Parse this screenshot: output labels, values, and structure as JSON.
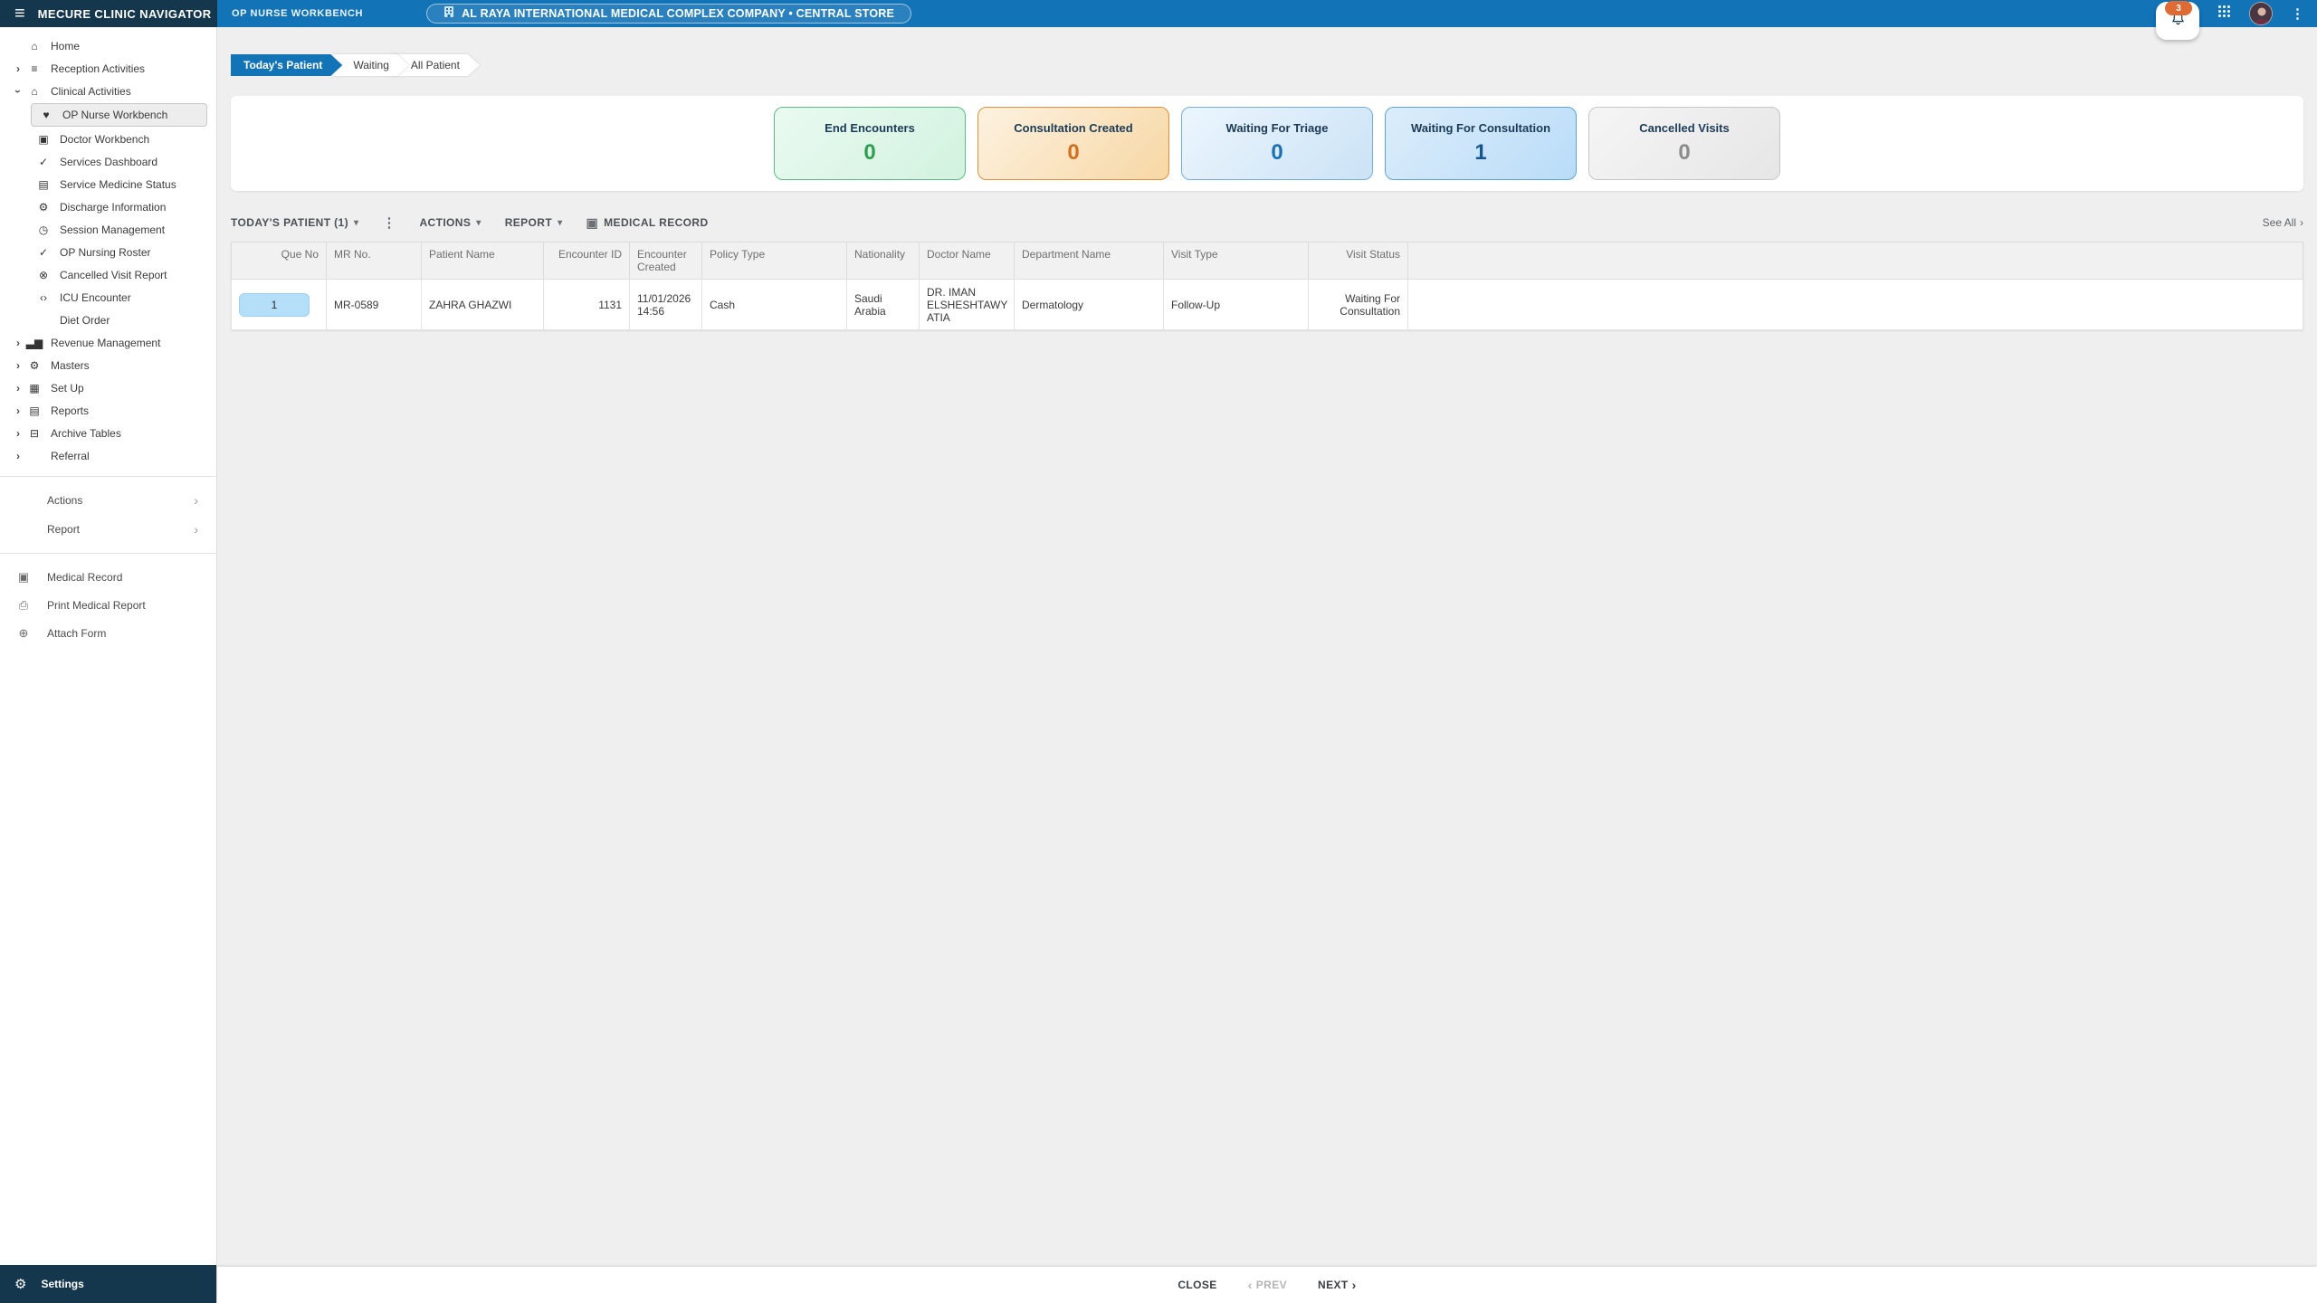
{
  "header": {
    "app_title": "MECURE CLINIC NAVIGATOR",
    "module_label": "OP NURSE WORKBENCH",
    "location_pill": "AL RAYA INTERNATIONAL MEDICAL COMPLEX COMPANY • CENTRAL STORE",
    "notification_count": "3"
  },
  "colors": {
    "primary_blue": "#1273b7",
    "navy": "#14374e",
    "notification_badge_orange": "#dd6b33",
    "card_green_border": "#5fbb85",
    "card_orange_border": "#e0903c",
    "card_blue_border": "#74aedd",
    "card_gray_border": "#c6c6c6",
    "que_badge_blue": "#b5dff8"
  },
  "sidebar": {
    "items": [
      {
        "label": "Home",
        "icon": "home",
        "glyph": "⌂",
        "level": 0,
        "chevron": null,
        "selected": false
      },
      {
        "label": "Reception Activities",
        "icon": "menu-lines",
        "glyph": "≡",
        "level": 0,
        "chevron": "right",
        "selected": false
      },
      {
        "label": "Clinical Activities",
        "icon": "clinic-building",
        "glyph": "⌂",
        "level": 0,
        "chevron": "down",
        "selected": false
      },
      {
        "label": "OP Nurse Workbench",
        "icon": "nurse-heart",
        "glyph": "♥",
        "level": 1,
        "chevron": null,
        "selected": true
      },
      {
        "label": "Doctor Workbench",
        "icon": "doctor-card",
        "glyph": "▣",
        "level": 1,
        "chevron": null,
        "selected": false
      },
      {
        "label": "Services Dashboard",
        "icon": "check",
        "glyph": "✓",
        "level": 1,
        "chevron": null,
        "selected": false
      },
      {
        "label": "Service Medicine Status",
        "icon": "list",
        "glyph": "▤",
        "level": 1,
        "chevron": null,
        "selected": false
      },
      {
        "label": "Discharge Information",
        "icon": "gear",
        "glyph": "⚙",
        "level": 1,
        "chevron": null,
        "selected": false
      },
      {
        "label": "Session Management",
        "icon": "clock",
        "glyph": "◷",
        "level": 1,
        "chevron": null,
        "selected": false
      },
      {
        "label": "OP Nursing Roster",
        "icon": "check",
        "glyph": "✓",
        "level": 1,
        "chevron": null,
        "selected": false
      },
      {
        "label": "Cancelled Visit Report",
        "icon": "cancel-circle",
        "glyph": "⊗",
        "level": 1,
        "chevron": null,
        "selected": false
      },
      {
        "label": "ICU Encounter",
        "icon": "code-brackets",
        "glyph": "‹›",
        "level": 1,
        "chevron": null,
        "selected": false
      },
      {
        "label": "Diet Order",
        "icon": "none",
        "glyph": "",
        "level": 1,
        "chevron": null,
        "selected": false
      },
      {
        "label": "Revenue Management",
        "icon": "bar-chart",
        "glyph": "▃▆",
        "level": 0,
        "chevron": "right",
        "selected": false
      },
      {
        "label": "Masters",
        "icon": "gear",
        "glyph": "⚙",
        "level": 0,
        "chevron": "right",
        "selected": false
      },
      {
        "label": "Set Up",
        "icon": "doc-search",
        "glyph": "▦",
        "level": 0,
        "chevron": "right",
        "selected": false
      },
      {
        "label": "Reports",
        "icon": "document",
        "glyph": "▤",
        "level": 0,
        "chevron": "right",
        "selected": false
      },
      {
        "label": "Archive Tables",
        "icon": "archive-box",
        "glyph": "⊟",
        "level": 0,
        "chevron": "right",
        "selected": false
      },
      {
        "label": "Referral",
        "icon": "none",
        "glyph": "",
        "level": 0,
        "chevron": "right",
        "selected": false
      }
    ],
    "actions_label": "Actions",
    "report_label": "Report",
    "tools": [
      {
        "label": "Medical Record",
        "icon": "clipboard",
        "glyph": "▣"
      },
      {
        "label": "Print Medical Report",
        "icon": "printer",
        "glyph": "⎙"
      },
      {
        "label": "Attach Form",
        "icon": "paperclip",
        "glyph": "⊕"
      }
    ],
    "settings_label": "Settings"
  },
  "tabs": [
    {
      "label": "Today's Patient",
      "active": true
    },
    {
      "label": "Waiting",
      "active": false
    },
    {
      "label": "All Patient",
      "active": false
    }
  ],
  "summary_cards": [
    {
      "label": "End Encounters",
      "value": "0",
      "theme": "green"
    },
    {
      "label": "Consultation Created",
      "value": "0",
      "theme": "orange"
    },
    {
      "label": "Waiting For Triage",
      "value": "0",
      "theme": "blue"
    },
    {
      "label": "Waiting For Consultation",
      "value": "1",
      "theme": "blue-strong"
    },
    {
      "label": "Cancelled Visits",
      "value": "0",
      "theme": "gray"
    }
  ],
  "toolbar": {
    "list_selector": "TODAY'S PATIENT (1)",
    "actions_label": "ACTIONS",
    "report_label": "REPORT",
    "medical_record_label": "MEDICAL RECORD",
    "see_all_label": "See All"
  },
  "table": {
    "columns": [
      "Que No",
      "MR No.",
      "Patient Name",
      "Encounter ID",
      "Encounter Created",
      "Policy Type",
      "Nationality",
      "Doctor Name",
      "Department Name",
      "Visit Type",
      "Visit Status"
    ],
    "rows": [
      {
        "que_no": "1",
        "mr_no": "MR-0589",
        "patient_name": "ZAHRA GHAZWI",
        "encounter_id": "1131",
        "encounter_created": "11/01/2026 14:56",
        "policy_type": "Cash",
        "nationality": "Saudi Arabia",
        "doctor_name": "DR. IMAN ELSHESHTAWY ATIA",
        "department_name": "Dermatology",
        "visit_type": "Follow-Up",
        "visit_status": "Waiting For Consultation"
      }
    ]
  },
  "footer": {
    "close_label": "CLOSE",
    "prev_label": "PREV",
    "next_label": "NEXT"
  }
}
